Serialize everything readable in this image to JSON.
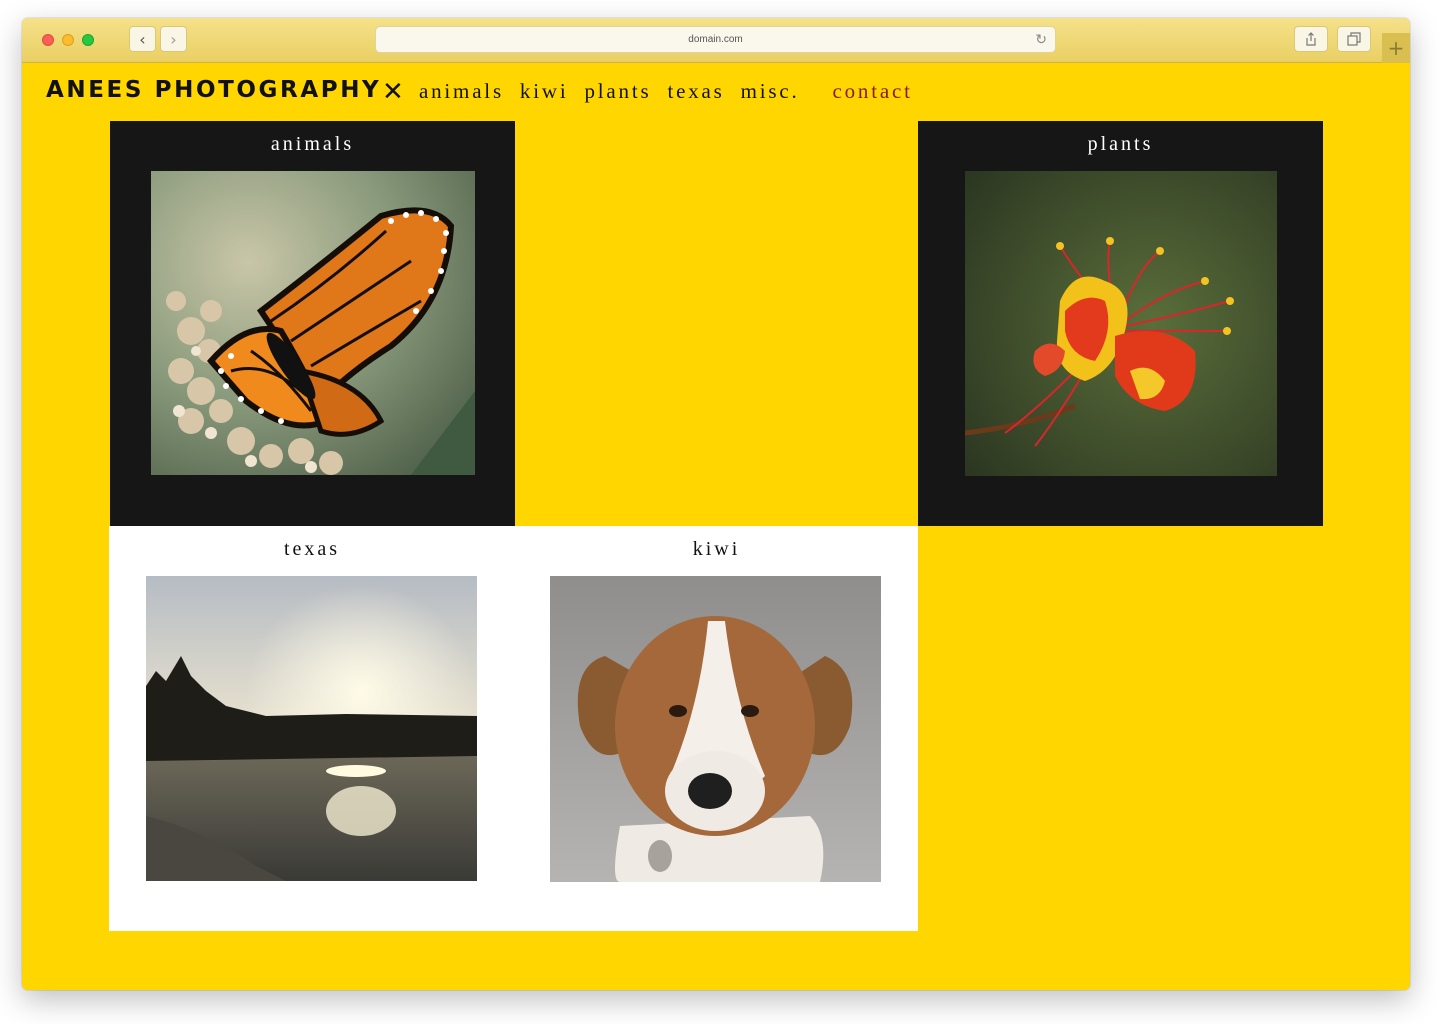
{
  "browser": {
    "url": "domain.com"
  },
  "site": {
    "brand": "ANEES PHOTOGRAPHY",
    "close_symbol": "✕",
    "nav": [
      {
        "label": "animals"
      },
      {
        "label": "kiwi"
      },
      {
        "label": "plants"
      },
      {
        "label": "texas"
      },
      {
        "label": "misc."
      }
    ],
    "contact_label": "contact"
  },
  "gallery": {
    "tiles": [
      {
        "title": "animals",
        "photo": "monarch butterfly on flowers"
      },
      {
        "title": "plants",
        "photo": "red and yellow flower"
      },
      {
        "title": "texas",
        "photo": "sunset over lake"
      },
      {
        "title": "kiwi",
        "photo": "brown and white puppy"
      }
    ]
  },
  "colors": {
    "background": "#FFD600",
    "dark_tile": "#161616",
    "light_tile": "#FFFFFF",
    "contact": "#8A1A1A"
  }
}
